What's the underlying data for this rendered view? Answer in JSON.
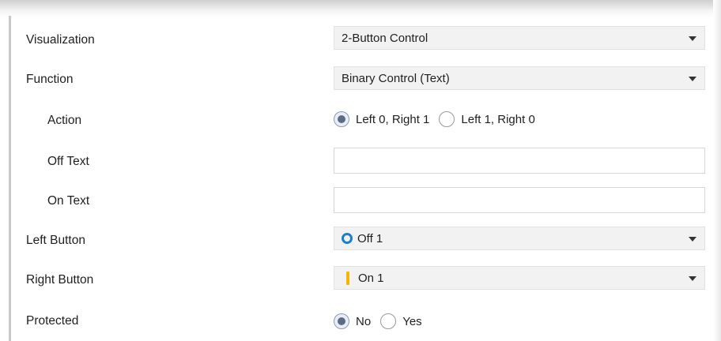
{
  "rows": {
    "visualization": {
      "label": "Visualization",
      "value": "2-Button Control"
    },
    "function": {
      "label": "Function",
      "value": "Binary Control (Text)"
    },
    "action": {
      "label": "Action",
      "options": [
        "Left 0, Right 1",
        "Left 1, Right 0"
      ],
      "selected": "Left 0, Right 1"
    },
    "off_text": {
      "label": "Off Text",
      "value": ""
    },
    "on_text": {
      "label": "On Text",
      "value": ""
    },
    "left_button": {
      "label": "Left Button",
      "value": "Off 1",
      "icon": "ring-icon",
      "icon_color": "#1b7fcf"
    },
    "right_button": {
      "label": "Right Button",
      "value": "On 1",
      "icon": "bar-icon",
      "icon_color": "#f2b800"
    },
    "protected": {
      "label": "Protected",
      "options": [
        "No",
        "Yes"
      ],
      "selected": "No"
    }
  }
}
